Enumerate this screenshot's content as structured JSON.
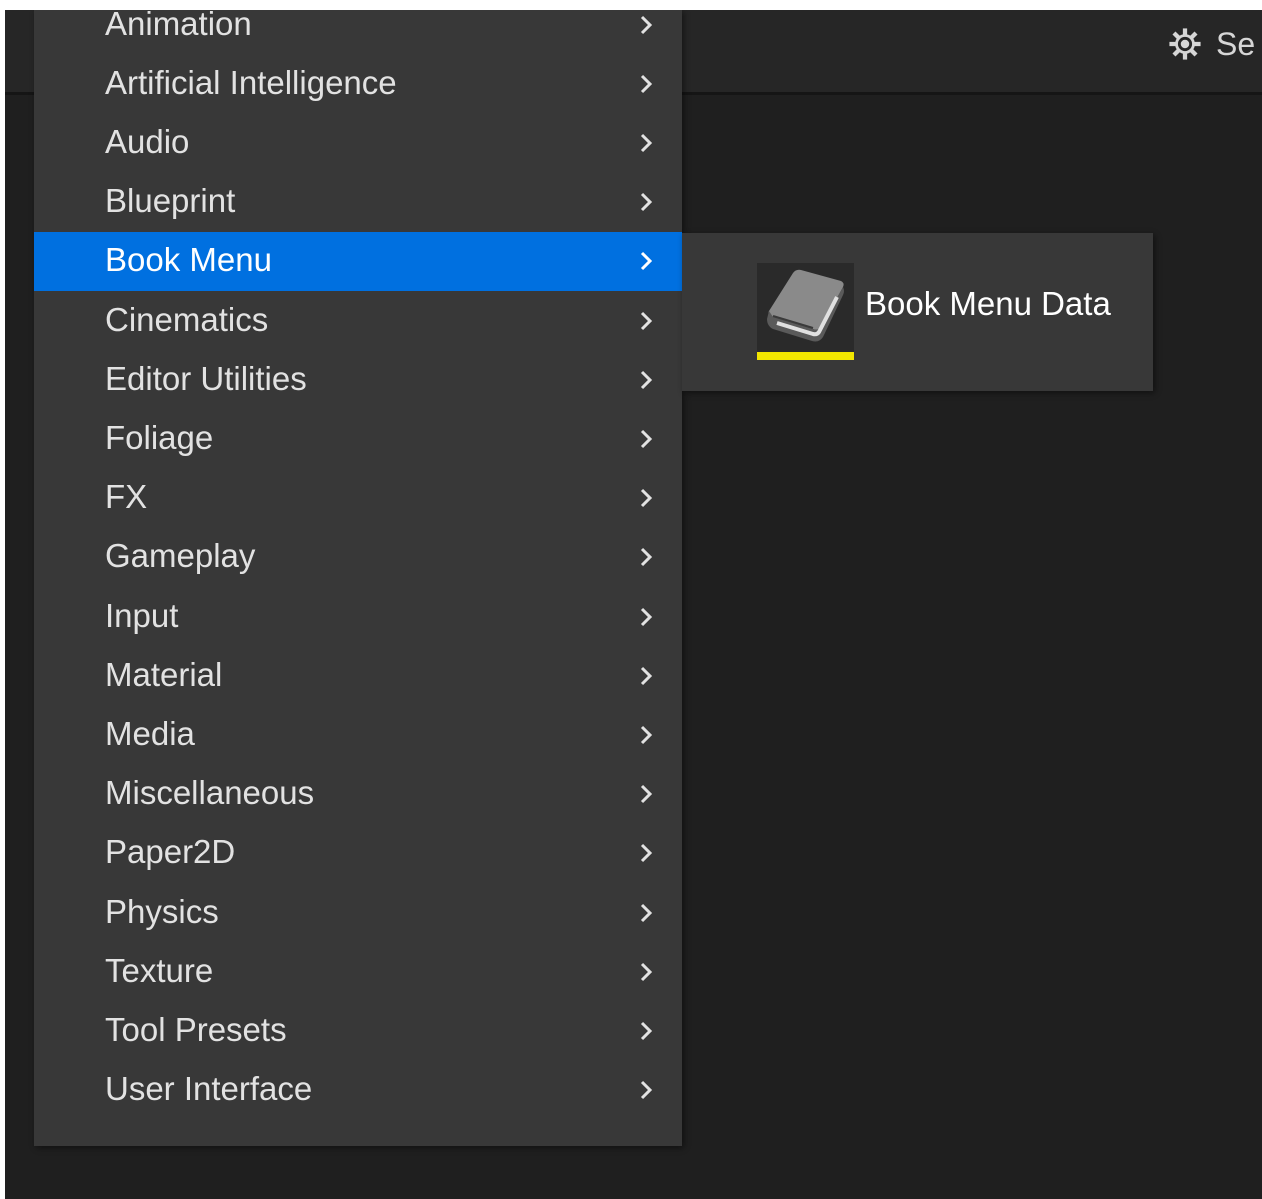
{
  "toolbar": {
    "settings_label": "Se",
    "settings_icon": "gear-icon"
  },
  "menu": {
    "items": [
      {
        "label": "Animation"
      },
      {
        "label": "Artificial Intelligence"
      },
      {
        "label": "Audio"
      },
      {
        "label": "Blueprint"
      },
      {
        "label": "Book Menu",
        "active": true
      },
      {
        "label": "Cinematics"
      },
      {
        "label": "Editor Utilities"
      },
      {
        "label": "Foliage"
      },
      {
        "label": "FX"
      },
      {
        "label": "Gameplay"
      },
      {
        "label": "Input"
      },
      {
        "label": "Material"
      },
      {
        "label": "Media"
      },
      {
        "label": "Miscellaneous"
      },
      {
        "label": "Paper2D"
      },
      {
        "label": "Physics"
      },
      {
        "label": "Texture"
      },
      {
        "label": "Tool Presets"
      },
      {
        "label": "User Interface"
      }
    ],
    "chevron_icon": "chevron-right-icon",
    "active_color": "#0070e0"
  },
  "submenu": {
    "items": [
      {
        "label": "Book Menu Data",
        "icon": "book-icon",
        "accent_color": "#f2e600"
      }
    ]
  }
}
